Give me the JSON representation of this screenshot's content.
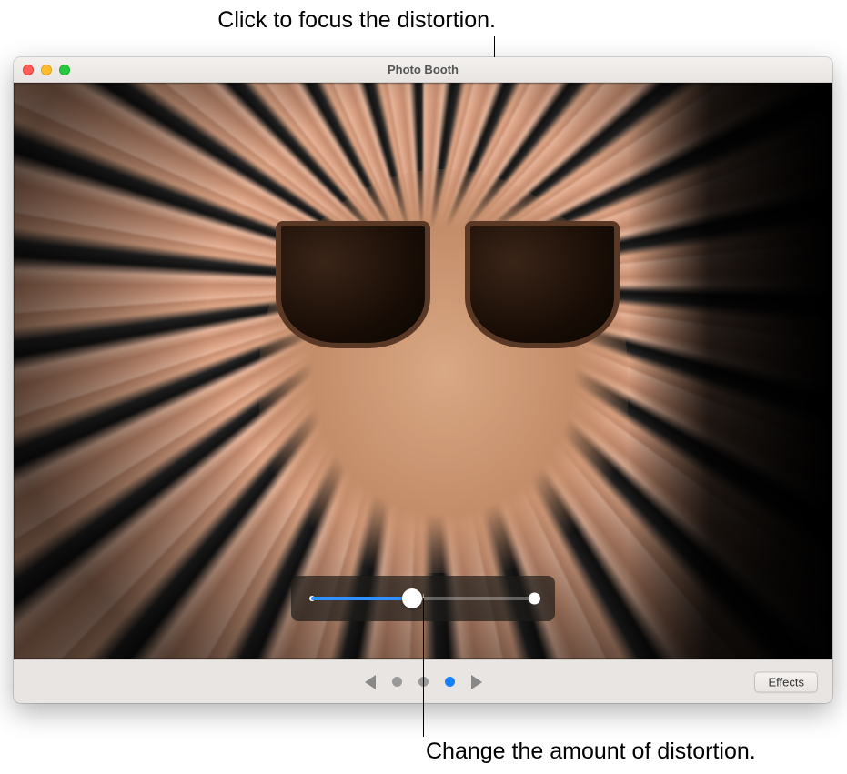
{
  "callouts": {
    "top": "Click to focus the distortion.",
    "bottom": "Change the amount of distortion."
  },
  "window": {
    "title": "Photo Booth"
  },
  "slider": {
    "value_percent": 45
  },
  "pager": {
    "selected_index": 2,
    "page_count": 3
  },
  "buttons": {
    "effects_label": "Effects"
  },
  "colors": {
    "accent": "#1780ff",
    "close": "#ff5f57",
    "minimize": "#febc2e",
    "zoom": "#28c840"
  }
}
